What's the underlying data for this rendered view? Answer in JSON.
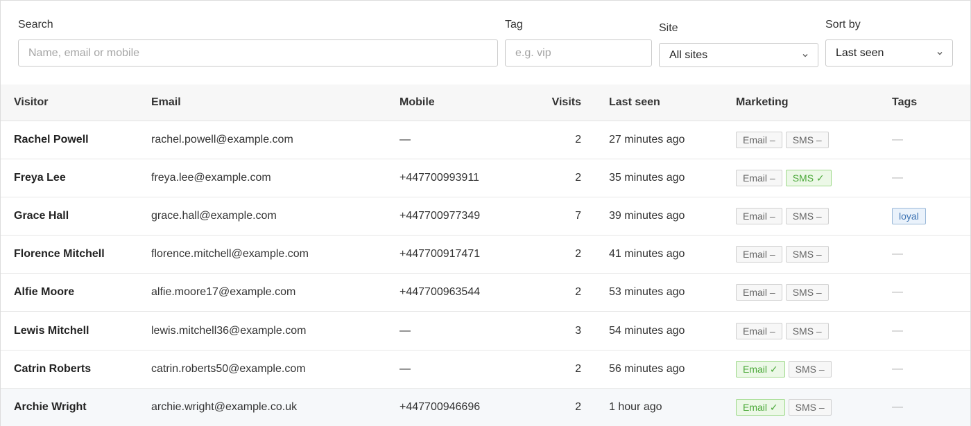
{
  "filters": {
    "search": {
      "label": "Search",
      "placeholder": "Name, email or mobile"
    },
    "tag": {
      "label": "Tag",
      "placeholder": "e.g. vip"
    },
    "site": {
      "label": "Site",
      "value": "All sites",
      "icon": "chevron-down-icon"
    },
    "sort": {
      "label": "Sort by",
      "value": "Last seen",
      "icon": "chevron-down-icon"
    }
  },
  "table": {
    "columns": [
      "Visitor",
      "Email",
      "Mobile",
      "Visits",
      "Last seen",
      "Marketing",
      "Tags"
    ],
    "rows": [
      {
        "visitor": "Rachel Powell",
        "email": "rachel.powell@example.com",
        "mobile": "—",
        "visits": "2",
        "last_seen": "27 minutes ago",
        "email_mkt": "Email –",
        "email_on": false,
        "sms_mkt": "SMS –",
        "sms_on": false,
        "tags": "—",
        "tag_is_badge": false
      },
      {
        "visitor": "Freya Lee",
        "email": "freya.lee@example.com",
        "mobile": "+447700993911",
        "visits": "2",
        "last_seen": "35 minutes ago",
        "email_mkt": "Email –",
        "email_on": false,
        "sms_mkt": "SMS ✓",
        "sms_on": true,
        "tags": "—",
        "tag_is_badge": false
      },
      {
        "visitor": "Grace Hall",
        "email": "grace.hall@example.com",
        "mobile": "+447700977349",
        "visits": "7",
        "last_seen": "39 minutes ago",
        "email_mkt": "Email –",
        "email_on": false,
        "sms_mkt": "SMS –",
        "sms_on": false,
        "tags": "loyal",
        "tag_is_badge": true
      },
      {
        "visitor": "Florence Mitchell",
        "email": "florence.mitchell@example.com",
        "mobile": "+447700917471",
        "visits": "2",
        "last_seen": "41 minutes ago",
        "email_mkt": "Email –",
        "email_on": false,
        "sms_mkt": "SMS –",
        "sms_on": false,
        "tags": "—",
        "tag_is_badge": false
      },
      {
        "visitor": "Alfie Moore",
        "email": "alfie.moore17@example.com",
        "mobile": "+447700963544",
        "visits": "2",
        "last_seen": "53 minutes ago",
        "email_mkt": "Email –",
        "email_on": false,
        "sms_mkt": "SMS –",
        "sms_on": false,
        "tags": "—",
        "tag_is_badge": false
      },
      {
        "visitor": "Lewis Mitchell",
        "email": "lewis.mitchell36@example.com",
        "mobile": "—",
        "visits": "3",
        "last_seen": "54 minutes ago",
        "email_mkt": "Email –",
        "email_on": false,
        "sms_mkt": "SMS –",
        "sms_on": false,
        "tags": "—",
        "tag_is_badge": false
      },
      {
        "visitor": "Catrin Roberts",
        "email": "catrin.roberts50@example.com",
        "mobile": "—",
        "visits": "2",
        "last_seen": "56 minutes ago",
        "email_mkt": "Email ✓",
        "email_on": true,
        "sms_mkt": "SMS –",
        "sms_on": false,
        "tags": "—",
        "tag_is_badge": false
      },
      {
        "visitor": "Archie Wright",
        "email": "archie.wright@example.co.uk",
        "mobile": "+447700946696",
        "visits": "2",
        "last_seen": "1 hour ago",
        "email_mkt": "Email ✓",
        "email_on": true,
        "sms_mkt": "SMS –",
        "sms_on": false,
        "tags": "—",
        "tag_is_badge": false
      }
    ]
  },
  "colors": {
    "accent_green": "#4aa838",
    "tag_blue": "#3d73b3"
  }
}
